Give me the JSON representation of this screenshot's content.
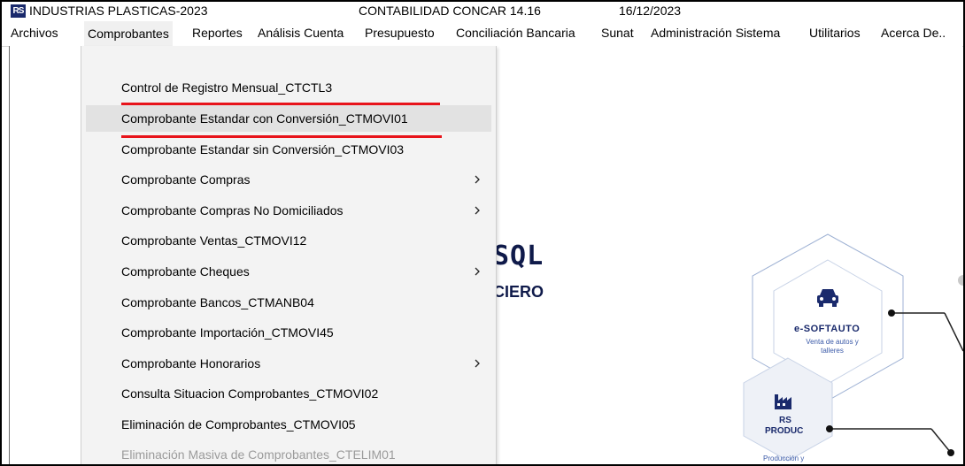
{
  "titlebar": {
    "app_icon": "RS",
    "company": "INDUSTRIAS PLASTICAS-2023",
    "app_name": "CONTABILIDAD CONCAR 14.16",
    "date": "16/12/2023"
  },
  "menubar": {
    "items": [
      {
        "label": "Archivos"
      },
      {
        "label": "Comprobantes"
      },
      {
        "label": "Reportes"
      },
      {
        "label": "Análisis Cuenta"
      },
      {
        "label": "Presupuesto"
      },
      {
        "label": "Conciliación Bancaria"
      },
      {
        "label": "Sunat"
      },
      {
        "label": "Administración Sistema"
      },
      {
        "label": "Utilitarios"
      },
      {
        "label": "Acerca De.."
      }
    ]
  },
  "dropdown": {
    "items": [
      {
        "label": "Control de Registro Mensual_CTCTL3",
        "submenu": false
      },
      {
        "label": "Comprobante Estandar con Conversión_CTMOVI01",
        "submenu": false,
        "highlighted": true
      },
      {
        "label": "Comprobante Estandar sin Conversión_CTMOVI03",
        "submenu": false
      },
      {
        "label": "Comprobante Compras",
        "submenu": true
      },
      {
        "label": "Comprobante Compras No Domiciliados",
        "submenu": true
      },
      {
        "label": "Comprobante Ventas_CTMOVI12",
        "submenu": false
      },
      {
        "label": "Comprobante Cheques",
        "submenu": true
      },
      {
        "label": "Comprobante Bancos_CTMANB04",
        "submenu": false
      },
      {
        "label": "Comprobante Importación_CTMOVI45",
        "submenu": false
      },
      {
        "label": "Comprobante Honorarios",
        "submenu": true
      },
      {
        "label": "Consulta Situacion Comprobantes_CTMOVI02",
        "submenu": false
      },
      {
        "label": "Eliminación de Comprobantes_CTMOVI05",
        "submenu": false
      },
      {
        "label": "Eliminación Masiva de Comprobantes_CTELIM01",
        "submenu": false,
        "disabled": true
      }
    ]
  },
  "background": {
    "brand_fragment": "SQL",
    "subtitle_fragment": "CIERO",
    "product1": {
      "name": "e-SOFTAUTO",
      "desc": "Venta de autos y talleres",
      "icon": "car-icon"
    },
    "product2": {
      "name_line1": "RS",
      "name_line2": "PRODUC",
      "desc": "Producción y",
      "icon": "factory-icon"
    }
  },
  "colors": {
    "annotation_red": "#e8141b",
    "brand_navy": "#1a2a6c",
    "menu_bg": "#f3f3f3",
    "highlight_bg": "#e2e2e2",
    "disabled_text": "#9b9b9b"
  }
}
